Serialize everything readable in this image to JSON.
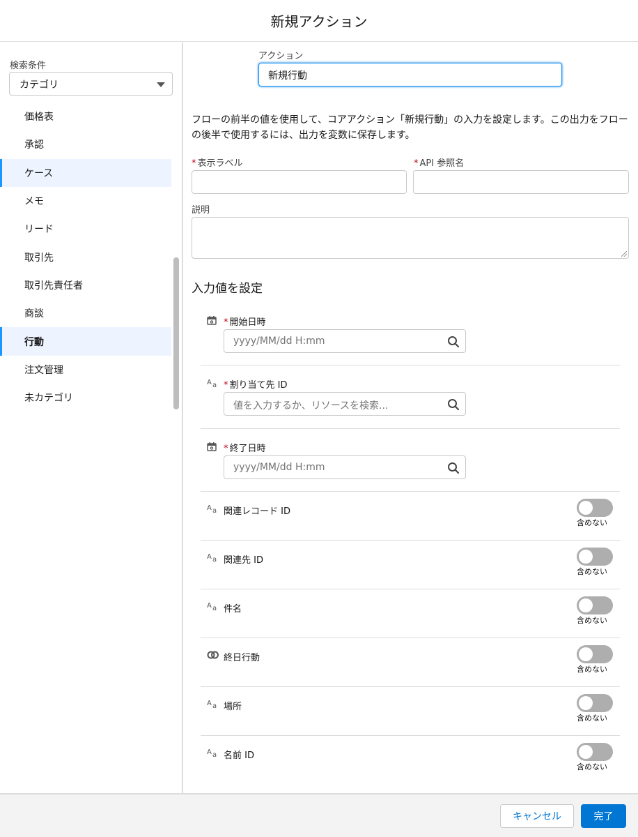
{
  "modal": {
    "title": "新規アクション"
  },
  "sidebar": {
    "filter_label": "検索条件",
    "filter_value": "カテゴリ",
    "categories": [
      {
        "label": "価格表",
        "selected": false
      },
      {
        "label": "承認",
        "selected": false
      },
      {
        "label": "ケース",
        "selected": true
      },
      {
        "label": "メモ",
        "selected": false
      },
      {
        "label": "リード",
        "selected": false
      },
      {
        "label": "取引先",
        "selected": false
      },
      {
        "label": "取引先責任者",
        "selected": false
      },
      {
        "label": "商談",
        "selected": false
      },
      {
        "label": "行動",
        "selected": true
      },
      {
        "label": "注文管理",
        "selected": false
      },
      {
        "label": "未カテゴリ",
        "selected": false
      }
    ]
  },
  "main": {
    "action_label": "アクション",
    "action_value": "新規行動",
    "description": "フローの前半の値を使用して、コアアクション「新規行動」の入力を設定します。この出力をフローの後半で使用するには、出力を変数に保存します。",
    "display_label": "表示ラベル",
    "api_name_label": "API 参照名",
    "description_label": "説明",
    "section_title": "入力値を設定",
    "params": [
      {
        "label": "開始日時",
        "required": true,
        "icon": "calendar-icon",
        "placeholder": "yyyy/MM/dd H:mm"
      },
      {
        "label": "割り当て先 ID",
        "required": true,
        "icon": "text-type-icon",
        "placeholder": "値を入力するか、リソースを検索..."
      },
      {
        "label": "終了日時",
        "required": true,
        "icon": "calendar-icon",
        "placeholder": "yyyy/MM/dd H:mm"
      }
    ],
    "optional_params": [
      {
        "label": "関連レコード ID",
        "icon": "text-type-icon",
        "toggle_label": "含めない"
      },
      {
        "label": "関連先 ID",
        "icon": "text-type-icon",
        "toggle_label": "含めない"
      },
      {
        "label": "件名",
        "icon": "text-type-icon",
        "toggle_label": "含めない"
      },
      {
        "label": "終日行動",
        "icon": "boolean-icon",
        "toggle_label": "含めない"
      },
      {
        "label": "場所",
        "icon": "text-type-icon",
        "toggle_label": "含めない"
      },
      {
        "label": "名前 ID",
        "icon": "text-type-icon",
        "toggle_label": "含めない"
      }
    ]
  },
  "footer": {
    "cancel_label": "キャンセル",
    "done_label": "完了"
  },
  "colors": {
    "brand": "#0176d3",
    "selected_bg": "#eef4ff",
    "required": "#ba0517"
  }
}
